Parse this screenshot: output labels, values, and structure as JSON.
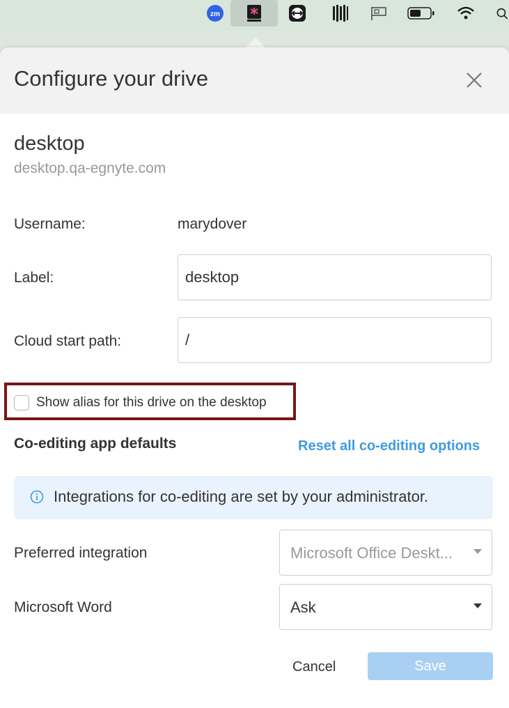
{
  "menubar": {
    "items": [
      {
        "icon": "zoom-icon",
        "text": "zm"
      },
      {
        "icon": "egnyte-drive-icon"
      },
      {
        "icon": "teamviewer-icon"
      },
      {
        "icon": "barcode-app-icon"
      },
      {
        "icon": "flag-display-icon"
      },
      {
        "icon": "battery-icon"
      },
      {
        "icon": "wifi-icon"
      },
      {
        "icon": "spotlight-search-icon"
      }
    ]
  },
  "dialog": {
    "title": "Configure your drive",
    "drive_name": "desktop",
    "drive_domain": "desktop.qa-egnyte.com",
    "username_label": "Username:",
    "username_value": "marydover",
    "label_label": "Label:",
    "label_value": "desktop",
    "cloud_path_label": "Cloud start path:",
    "cloud_path_value": "/",
    "show_alias_label": "Show alias for this drive on the desktop",
    "show_alias_checked": false,
    "coediting_heading": "Co-editing app defaults",
    "reset_link": "Reset all co-editing options",
    "info_text": "Integrations for co-editing are set by your administrator.",
    "preferred_integration_label": "Preferred integration",
    "preferred_integration_value": "Microsoft Office Deskt...",
    "word_label": "Microsoft Word",
    "word_value": "Ask",
    "cancel_label": "Cancel",
    "save_label": "Save"
  },
  "colors": {
    "accent": "#3f9be0",
    "save_disabled": "#a9d0f3",
    "highlight_border": "#7a1416",
    "info_bg": "#e9f3fd"
  }
}
